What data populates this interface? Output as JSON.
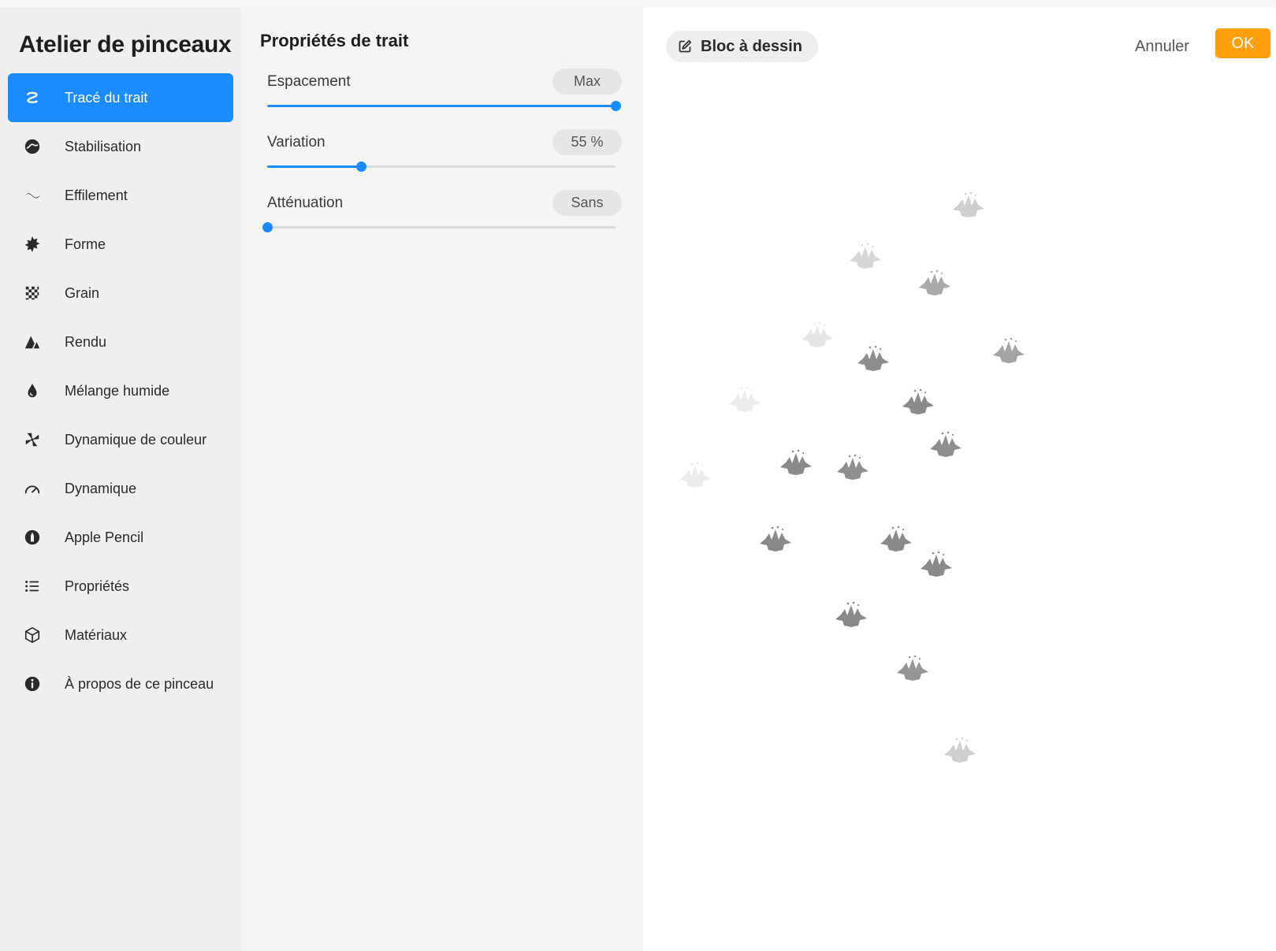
{
  "app": {
    "title": "Atelier de pinceaux"
  },
  "sidebar": {
    "items": [
      {
        "label": "Tracé du trait",
        "icon": "stroke-path-icon",
        "active": true
      },
      {
        "label": "Stabilisation",
        "icon": "stabilization-icon",
        "active": false
      },
      {
        "label": "Effilement",
        "icon": "taper-icon",
        "active": false
      },
      {
        "label": "Forme",
        "icon": "shape-icon",
        "active": false
      },
      {
        "label": "Grain",
        "icon": "grain-icon",
        "active": false
      },
      {
        "label": "Rendu",
        "icon": "rendering-icon",
        "active": false
      },
      {
        "label": "Mélange humide",
        "icon": "wet-mix-icon",
        "active": false
      },
      {
        "label": "Dynamique de couleur",
        "icon": "color-dynamics-icon",
        "active": false
      },
      {
        "label": "Dynamique",
        "icon": "dynamics-icon",
        "active": false
      },
      {
        "label": "Apple Pencil",
        "icon": "apple-pencil-icon",
        "active": false
      },
      {
        "label": "Propriétés",
        "icon": "properties-icon",
        "active": false
      },
      {
        "label": "Matériaux",
        "icon": "materials-icon",
        "active": false
      },
      {
        "label": "À propos de ce pinceau",
        "icon": "info-icon",
        "active": false
      }
    ]
  },
  "settings": {
    "title": "Propriétés de trait",
    "sliders": [
      {
        "label": "Espacement",
        "value_text": "Max",
        "fraction": 1.0
      },
      {
        "label": "Variation",
        "value_text": "55 %",
        "fraction": 0.27
      },
      {
        "label": "Atténuation",
        "value_text": "Sans",
        "fraction": 0.0
      }
    ]
  },
  "canvas": {
    "drawing_pad_label": "Bloc à dessin",
    "drawing_pad_icon": "edit-icon",
    "cancel_label": "Annuler",
    "ok_label": "OK"
  },
  "colors": {
    "accent": "#1a8cff",
    "ok_button": "#ff9f0a",
    "sidebar_bg": "#efefef",
    "panel_bg": "#f5f5f5",
    "canvas_bg": "#ffffff"
  }
}
